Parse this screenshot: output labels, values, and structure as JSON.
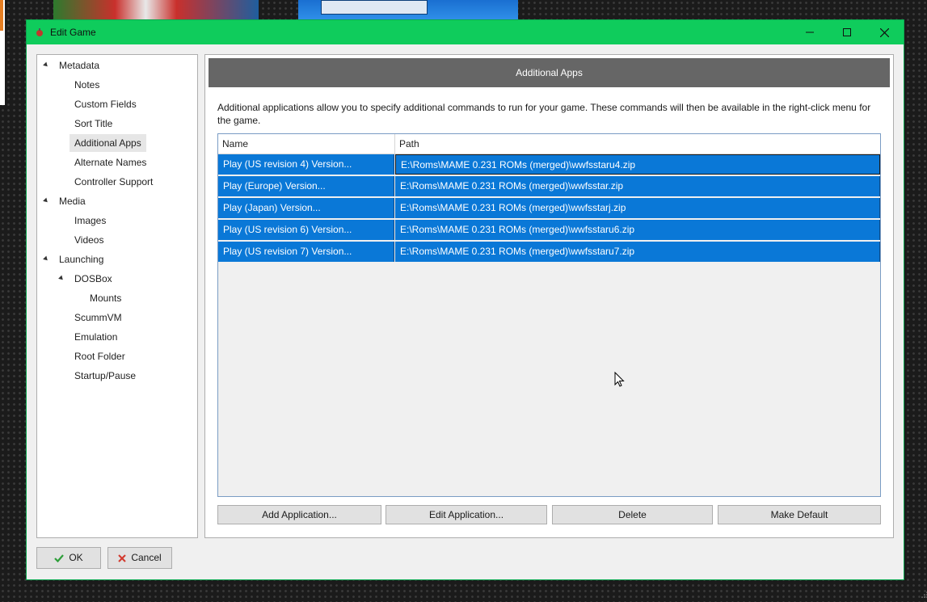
{
  "window": {
    "title": "Edit Game",
    "icon": "game-icon"
  },
  "window_controls": {
    "minimize": "minimize-icon",
    "maximize": "maximize-icon",
    "close": "close-icon"
  },
  "tree": {
    "items": [
      {
        "label": "Metadata",
        "expanded": true
      },
      {
        "label": "Notes"
      },
      {
        "label": "Custom Fields"
      },
      {
        "label": "Sort Title"
      },
      {
        "label": "Additional Apps",
        "selected": true
      },
      {
        "label": "Alternate Names"
      },
      {
        "label": "Controller Support"
      },
      {
        "label": "Media",
        "expanded": true
      },
      {
        "label": "Images"
      },
      {
        "label": "Videos"
      },
      {
        "label": "Launching",
        "expanded": true
      },
      {
        "label": "DOSBox",
        "expanded": true
      },
      {
        "label": "Mounts"
      },
      {
        "label": "ScummVM"
      },
      {
        "label": "Emulation"
      },
      {
        "label": "Root Folder"
      },
      {
        "label": "Startup/Pause"
      }
    ]
  },
  "panel": {
    "header": "Additional Apps",
    "description": "Additional applications allow you to specify additional commands to run for your game.  These commands will then be available in the right-click menu for the game.",
    "columns": [
      "Name",
      "Path"
    ],
    "rows": [
      {
        "name": "Play (US revision 4) Version...",
        "path": "E:\\Roms\\MAME 0.231 ROMs (merged)\\wwfsstaru4.zip"
      },
      {
        "name": "Play (Europe) Version...",
        "path": "E:\\Roms\\MAME 0.231 ROMs (merged)\\wwfsstar.zip"
      },
      {
        "name": "Play (Japan) Version...",
        "path": "E:\\Roms\\MAME 0.231 ROMs (merged)\\wwfsstarj.zip"
      },
      {
        "name": "Play (US revision 6) Version...",
        "path": "E:\\Roms\\MAME 0.231 ROMs (merged)\\wwfsstaru6.zip"
      },
      {
        "name": "Play (US revision 7) Version...",
        "path": "E:\\Roms\\MAME 0.231 ROMs (merged)\\wwfsstaru7.zip"
      }
    ],
    "buttons": {
      "add": "Add Application...",
      "edit": "Edit Application...",
      "delete": "Delete",
      "make_default": "Make Default"
    }
  },
  "footer": {
    "ok": "OK",
    "cancel": "Cancel"
  },
  "colors": {
    "titlebar": "#0fcc5c",
    "selection": "#0a78d7",
    "header": "#666666"
  }
}
